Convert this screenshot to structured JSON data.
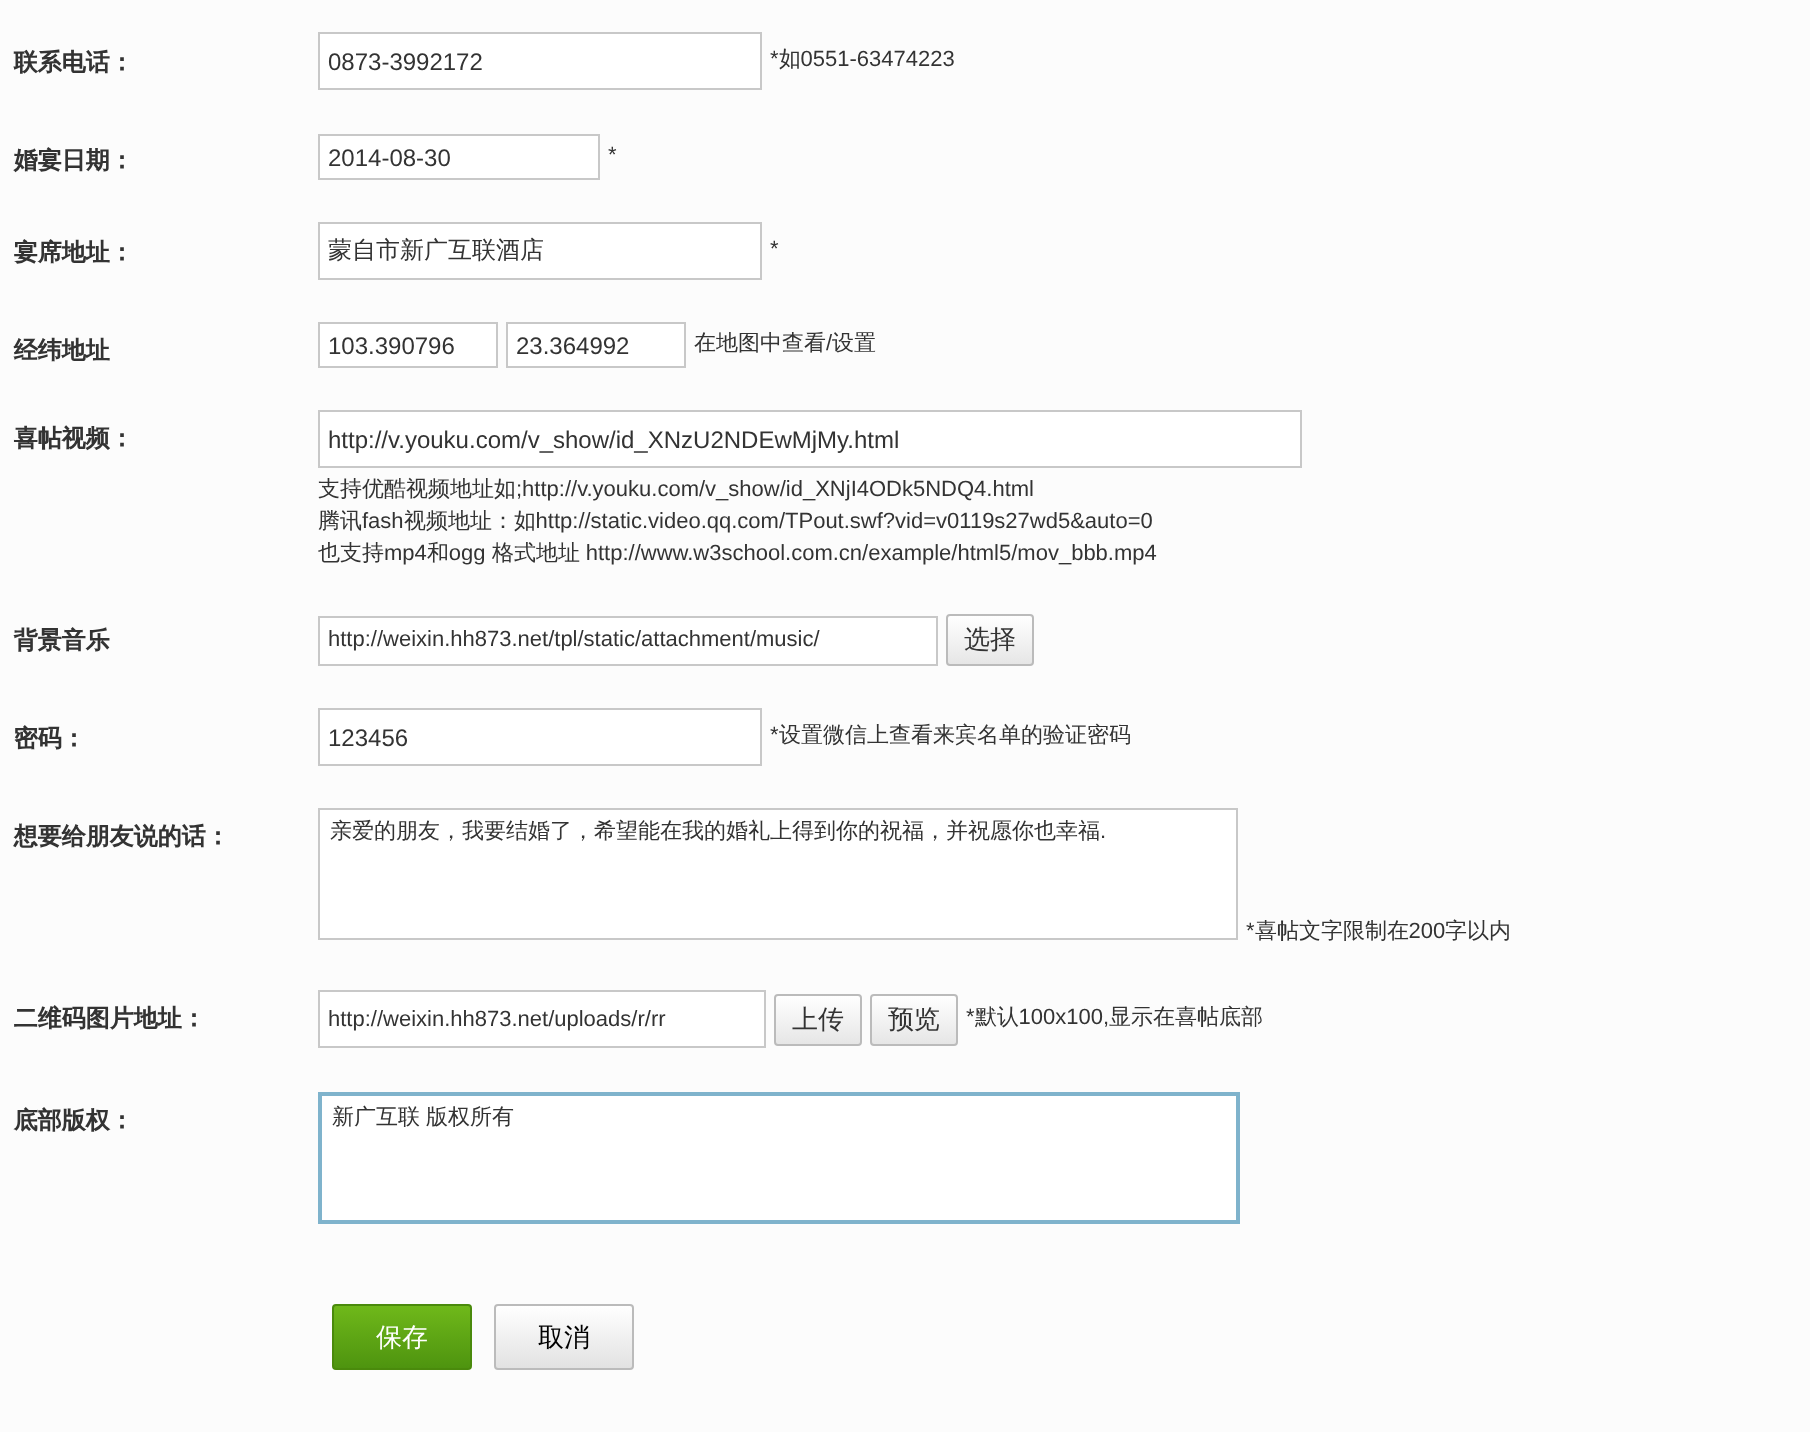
{
  "rows": [
    {
      "kind": "text",
      "label": "联系电话：",
      "fields": [
        {
          "value": "0873-3992172"
        }
      ],
      "note": "*如0551-63474223"
    },
    {
      "kind": "text",
      "label": "婚宴日期：",
      "fields": [
        {
          "value": "2014-08-30"
        }
      ],
      "note": "*"
    },
    {
      "kind": "text",
      "label": "宴席地址：",
      "fields": [
        {
          "value": "蒙自市新广互联酒店"
        }
      ],
      "note": "*"
    },
    {
      "kind": "text",
      "label": "经纬地址",
      "fields": [
        {
          "value": "103.390796"
        },
        {
          "value": "23.364992"
        }
      ],
      "note": "在地图中查看/设置"
    },
    {
      "kind": "video",
      "label": "喜帖视频：",
      "fields": [
        {
          "value": "http://v.youku.com/v_show/id_XNzU2NDEwMjMy.html"
        }
      ],
      "hints": [
        "支持优酷视频地址如;http://v.youku.com/v_show/id_XNjI4ODk5NDQ4.html",
        "腾讯fash视频地址：如http://static.video.qq.com/TPout.swf?vid=v0119s27wd5&auto=0",
        "也支持mp4和ogg 格式地址 http://www.w3school.com.cn/example/html5/mov_bbb.mp4"
      ]
    },
    {
      "kind": "text",
      "label": "背景音乐",
      "fields": [
        {
          "value": "http://weixin.hh873.net/tpl/static/attachment/music/"
        }
      ],
      "buttons": [
        "选择"
      ]
    },
    {
      "kind": "text",
      "label": "密码：",
      "fields": [
        {
          "value": "123456"
        }
      ],
      "note": "*设置微信上查看来宾名单的验证密码"
    },
    {
      "kind": "textarea",
      "label": "想要给朋友说的话：",
      "fields": [
        {
          "value": "亲爱的朋友，我要结婚了，希望能在我的婚礼上得到你的祝福，并祝愿你也幸福.",
          "focused": false
        }
      ],
      "note": "*喜帖文字限制在200字以内"
    },
    {
      "kind": "text",
      "label": "二维码图片地址：",
      "fields": [
        {
          "value": "http://weixin.hh873.net/uploads/r/rr"
        }
      ],
      "buttons": [
        "上传",
        "预览"
      ],
      "note": "*默认100x100,显示在喜帖底部"
    },
    {
      "kind": "textarea",
      "label": "底部版权：",
      "fields": [
        {
          "value": "新广互联 版权所有",
          "focused": true
        }
      ]
    }
  ],
  "actions": [
    {
      "label": "保存",
      "primary": true
    },
    {
      "label": "取消",
      "primary": false
    }
  ]
}
